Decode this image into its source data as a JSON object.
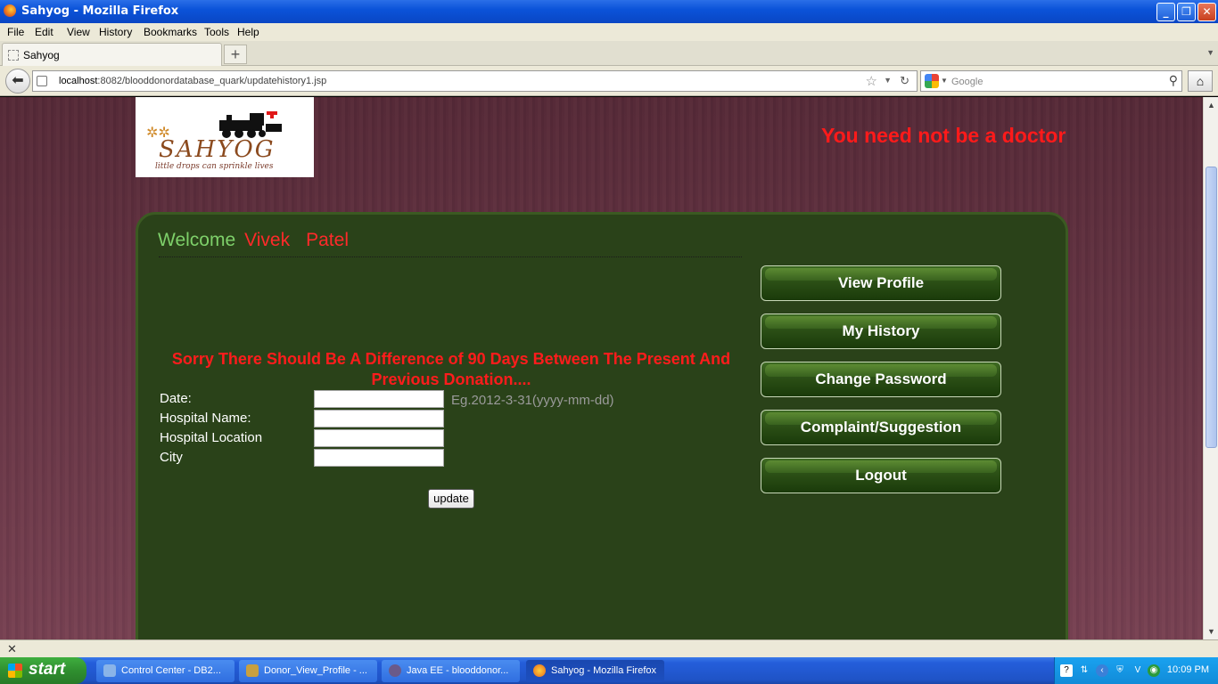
{
  "window": {
    "title": "Sahyog - Mozilla Firefox",
    "minimize": "_",
    "restore": "❐",
    "close": "✕"
  },
  "menu": [
    "File",
    "Edit",
    "View",
    "History",
    "Bookmarks",
    "Tools",
    "Help"
  ],
  "tab": {
    "label": "Sahyog",
    "new_tab": "+"
  },
  "address": {
    "host": "localhost",
    "path": ":8082/blooddonordatabase_quark/updatehistory1.jsp"
  },
  "search": {
    "placeholder": "Google"
  },
  "logo": {
    "brand": "SAHYOG",
    "tagline": "little drops can sprinkle lives"
  },
  "marquee": "You need not be a doctor",
  "welcome": {
    "label": "Welcome",
    "first": "Vivek",
    "last": "Patel"
  },
  "error": "Sorry There Should Be A Difference of 90 Days Between The Present And Previous Donation....",
  "form": {
    "date_label": "Date:",
    "date_hint": "Eg.2012-3-31(yyyy-mm-dd)",
    "hospital_name_label": "Hospital Name:",
    "hospital_location_label": "Hospital Location",
    "city_label": "City",
    "date_value": "",
    "hospital_name_value": "",
    "hospital_location_value": "",
    "city_value": "",
    "submit": "update"
  },
  "side_menu": [
    "View Profile",
    "My History",
    "Change Password",
    "Complaint/Suggestion",
    "Logout"
  ],
  "taskbar": {
    "start": "start",
    "tasks": [
      "Control Center - DB2...",
      "Donor_View_Profile - ...",
      "Java EE - blooddonor...",
      "Sahyog - Mozilla Firefox"
    ],
    "clock": "10:09 PM"
  }
}
